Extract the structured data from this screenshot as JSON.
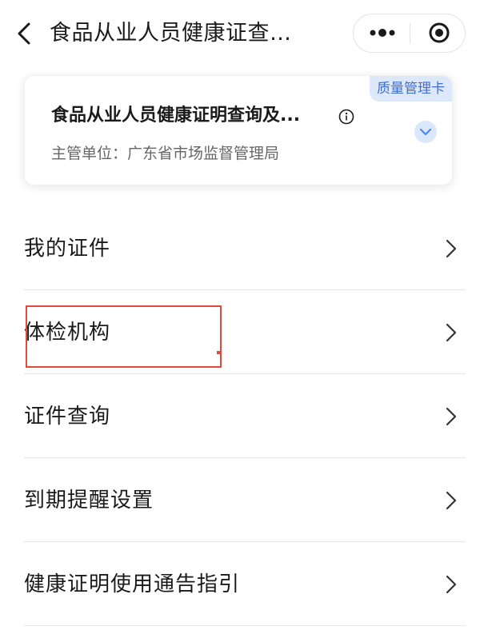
{
  "navbar": {
    "title": "食品从业人员健康证查…"
  },
  "card": {
    "badge": "质量管理卡",
    "title": "食品从业人员健康证明查询及...",
    "subtitle": "主管单位：广东省市场监督管理局"
  },
  "menu": {
    "items": [
      {
        "label": "我的证件"
      },
      {
        "label": "体检机构"
      },
      {
        "label": "证件查询"
      },
      {
        "label": "到期提醒设置"
      },
      {
        "label": "健康证明使用通告指引"
      }
    ]
  },
  "colors": {
    "highlight": "#e04a3b",
    "badge_bg": "#dde8fb",
    "badge_text": "#3f6fd6",
    "accent": "#4f86f0"
  }
}
